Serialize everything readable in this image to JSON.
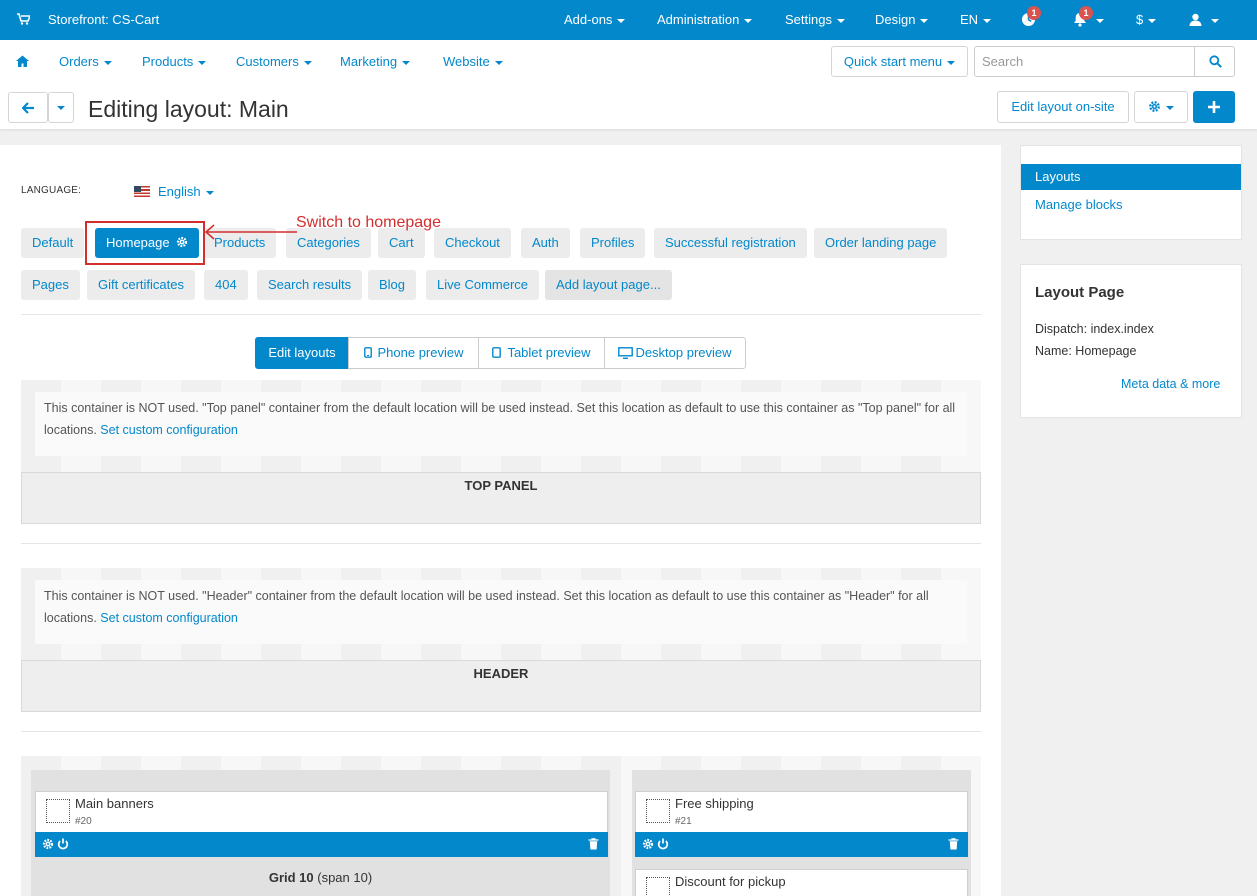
{
  "topbar": {
    "store": "Storefront: CS-Cart",
    "menus": [
      {
        "label": "Add-ons"
      },
      {
        "label": "Administration"
      },
      {
        "label": "Settings"
      },
      {
        "label": "Design"
      },
      {
        "label": "EN"
      }
    ],
    "clock_badge": "1",
    "bell_badge": "1",
    "currency": "$"
  },
  "nav": {
    "items": [
      {
        "label": "Orders"
      },
      {
        "label": "Products"
      },
      {
        "label": "Customers"
      },
      {
        "label": "Marketing"
      },
      {
        "label": "Website"
      }
    ],
    "quick_start": "Quick start menu",
    "search_placeholder": "Search"
  },
  "header": {
    "title": "Editing layout: Main",
    "edit_onsite": "Edit layout on-site"
  },
  "language": {
    "label": "LANGUAGE:",
    "value": "English"
  },
  "page_tabs_row1": [
    {
      "label": "Default"
    },
    {
      "label": "Homepage"
    },
    {
      "label": "Products"
    },
    {
      "label": "Categories"
    },
    {
      "label": "Cart"
    },
    {
      "label": "Checkout"
    },
    {
      "label": "Auth"
    },
    {
      "label": "Profiles"
    },
    {
      "label": "Successful registration"
    },
    {
      "label": "Order landing page"
    }
  ],
  "page_tabs_row2": [
    {
      "label": "Pages"
    },
    {
      "label": "Gift certificates"
    },
    {
      "label": "404"
    },
    {
      "label": "Search results"
    },
    {
      "label": "Blog"
    },
    {
      "label": "Live Commerce"
    },
    {
      "label": "Add layout page..."
    }
  ],
  "annotation": "Switch to homepage",
  "preview_tabs": [
    {
      "label": "Edit layouts"
    },
    {
      "label": "Phone preview"
    },
    {
      "label": "Tablet preview"
    },
    {
      "label": "Desktop preview"
    }
  ],
  "top_panel": {
    "notice": "This container is NOT used. \"Top panel\" container from the default location will be used instead. Set this location as default to use this container as \"Top panel\" for all locations.",
    "link": "Set custom configuration",
    "name": "TOP PANEL"
  },
  "header_container": {
    "notice": "This container is NOT used. \"Header\" container from the default location will be used instead. Set this location as default to use this container as \"Header\" for all locations.",
    "link": "Set custom configuration",
    "name": "HEADER"
  },
  "blocks": [
    {
      "name": "Main banners",
      "id": "#20"
    },
    {
      "name": "Free shipping",
      "id": "#21"
    },
    {
      "name": "Discount for pickup"
    }
  ],
  "grid_label": {
    "name": "Grid 10",
    "span": "(span 10)"
  },
  "sidebar": {
    "items": [
      {
        "label": "Layouts"
      },
      {
        "label": "Manage blocks"
      }
    ],
    "layout_page": {
      "title": "Layout Page",
      "dispatch": "Dispatch: index.index",
      "name": "Name: Homepage",
      "meta_link": "Meta data & more"
    }
  },
  "colors": {
    "accent": "#0388cc",
    "annotation": "#d32f2f"
  }
}
